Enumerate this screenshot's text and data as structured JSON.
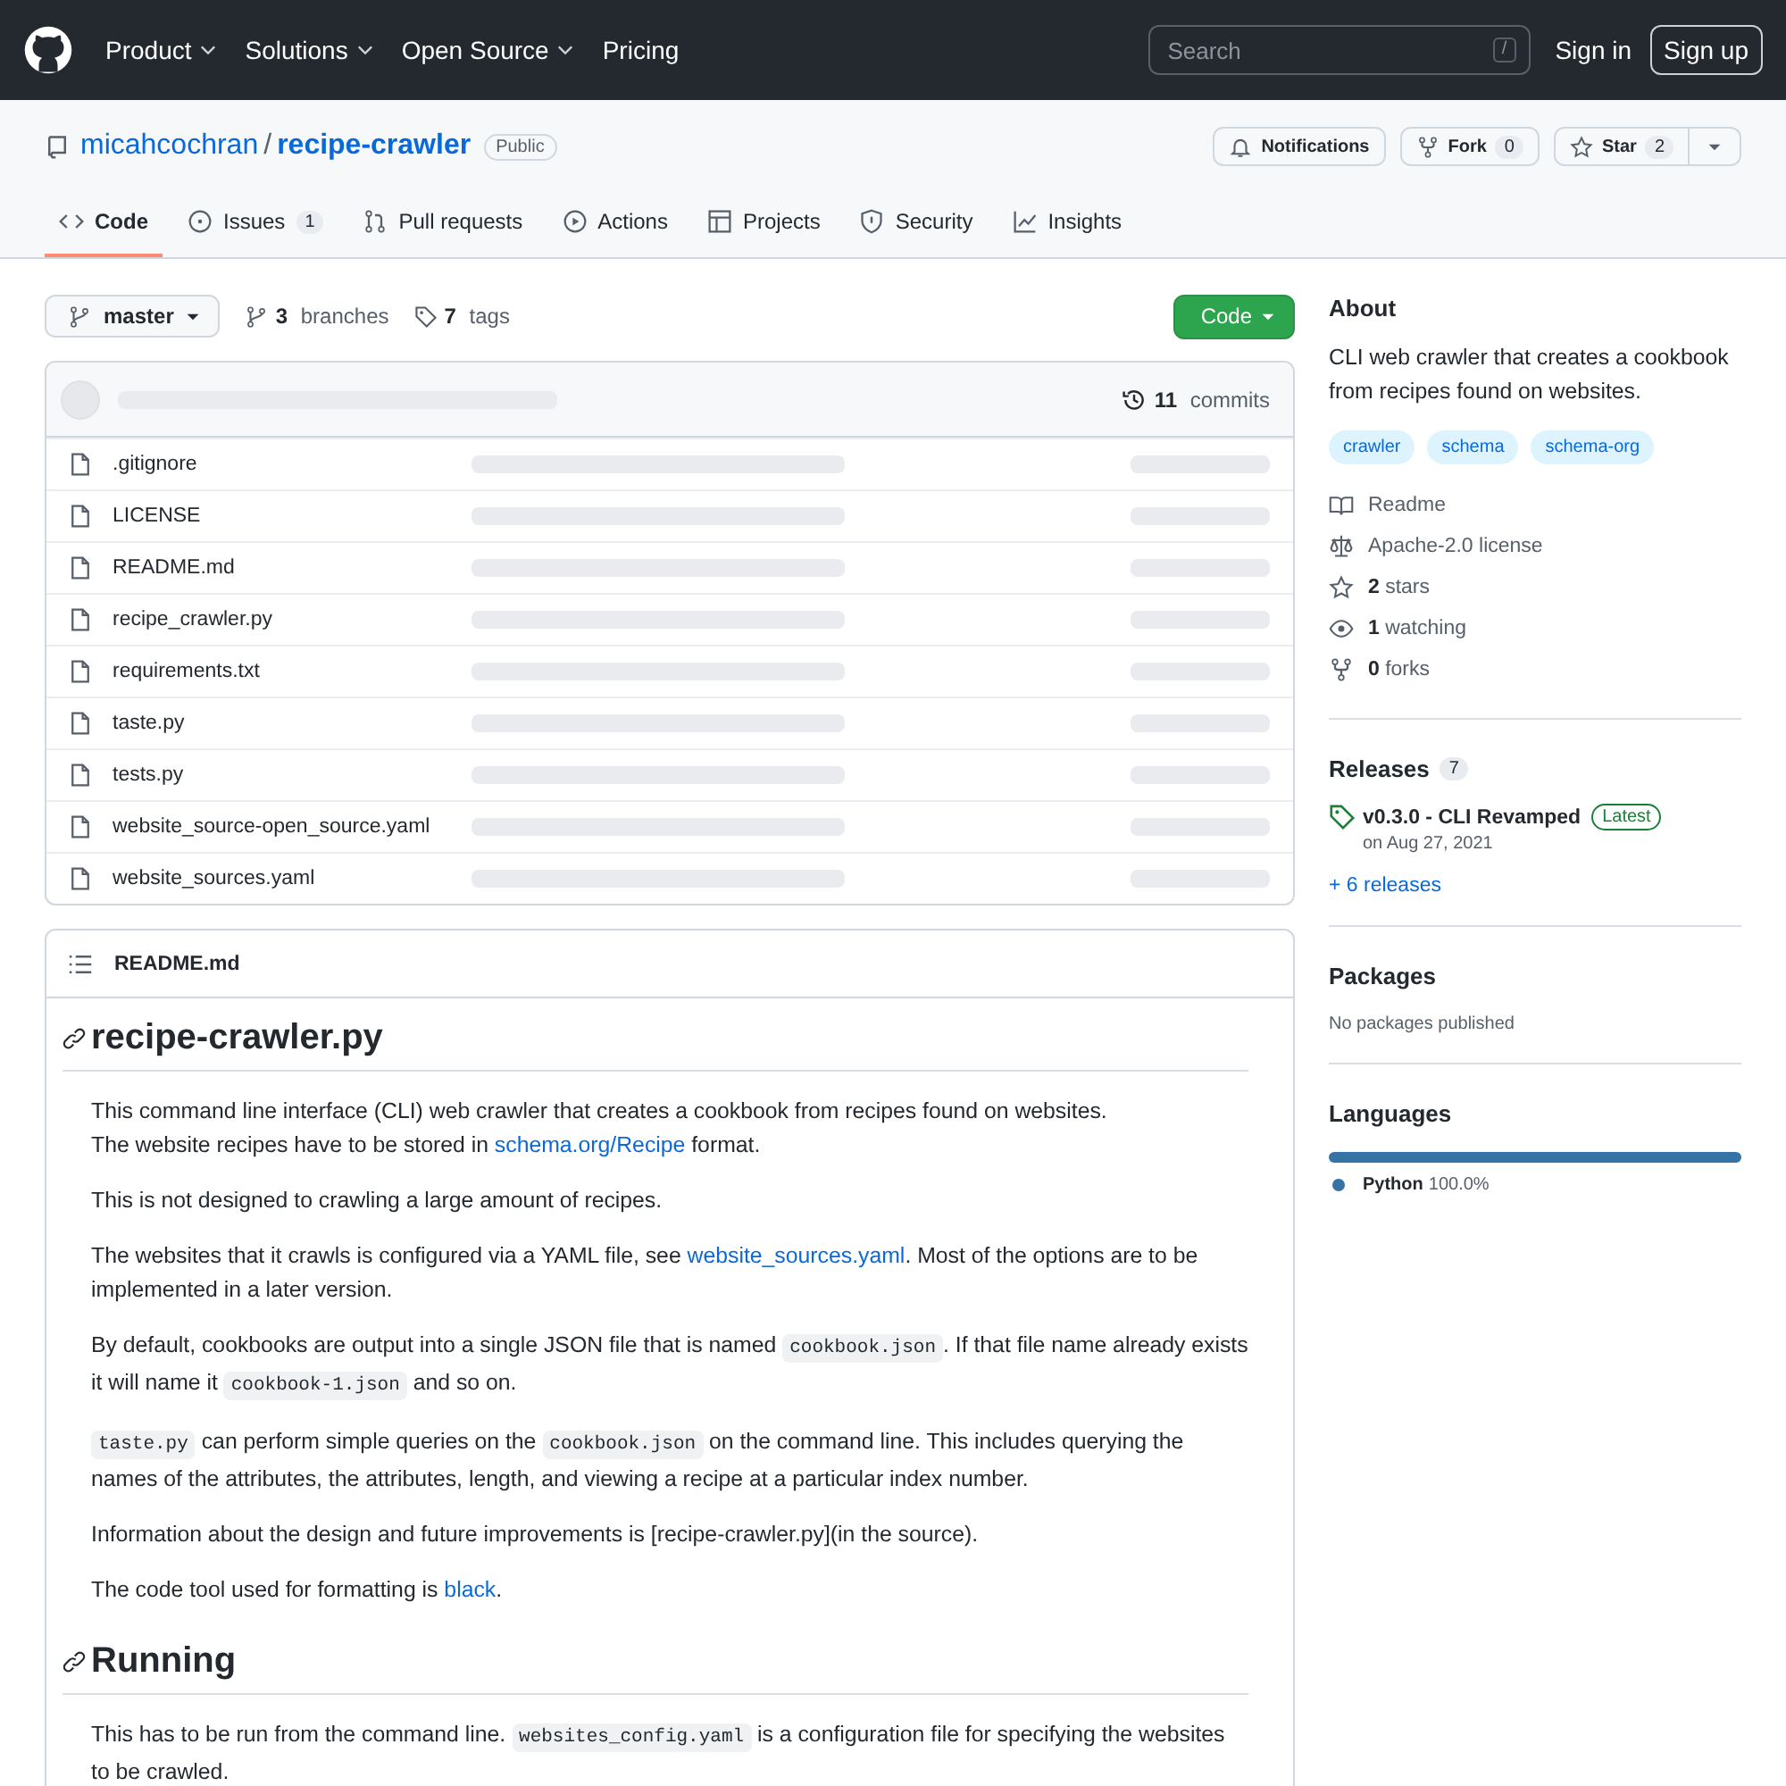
{
  "header": {
    "nav": [
      {
        "label": "Product",
        "dropdown": true
      },
      {
        "label": "Solutions",
        "dropdown": true
      },
      {
        "label": "Open Source",
        "dropdown": true
      },
      {
        "label": "Pricing",
        "dropdown": false
      }
    ],
    "search": {
      "placeholder": "Search",
      "key": "/"
    },
    "sign_in": "Sign in",
    "sign_up": "Sign up"
  },
  "repo": {
    "owner": "micahcochran",
    "separator": "/",
    "name": "recipe-crawler",
    "visibility": "Public",
    "actions": [
      {
        "label": "Notifications"
      },
      {
        "label": "Fork",
        "count": "0"
      },
      {
        "label": "Star",
        "count": "2"
      }
    ]
  },
  "tabs": [
    {
      "label": "Code",
      "selected": true
    },
    {
      "label": "Issues",
      "count": "1",
      "selected": false
    },
    {
      "label": "Pull requests",
      "selected": false
    },
    {
      "label": "Actions",
      "selected": false
    },
    {
      "label": "Projects",
      "selected": false
    },
    {
      "label": "Security",
      "selected": false
    },
    {
      "label": "Insights",
      "selected": false
    }
  ],
  "branch_bar": {
    "branch": "master",
    "branches": {
      "count": "3",
      "label": "branches"
    },
    "tags": {
      "count": "7",
      "label": "tags"
    },
    "code_button": "Code"
  },
  "commits": {
    "count": "11",
    "label": "commits"
  },
  "files": [
    ".gitignore",
    "LICENSE",
    "README.md",
    "recipe_crawler.py",
    "requirements.txt",
    "taste.py",
    "tests.py",
    "website_source-open_source.yaml",
    "website_sources.yaml"
  ],
  "readme": {
    "title": "README.md",
    "blocks": [
      {
        "kind": "h1",
        "text": "recipe-crawler.py"
      },
      {
        "kind": "p",
        "segments": [
          {
            "kind": "text",
            "text": "This command line interface (CLI) web crawler that creates a cookbook from recipes found on websites."
          },
          {
            "kind": "br"
          },
          {
            "kind": "text",
            "text": "The website recipes have to be stored in "
          },
          {
            "kind": "link",
            "text": "schema.org/Recipe"
          },
          {
            "kind": "text",
            "text": " format."
          }
        ]
      },
      {
        "kind": "p",
        "segments": [
          {
            "kind": "text",
            "text": "This is not designed to crawling a large amount of recipes."
          }
        ]
      },
      {
        "kind": "p",
        "segments": [
          {
            "kind": "text",
            "text": "The websites that it crawls is configured via a YAML file, see "
          },
          {
            "kind": "link",
            "text": "website_sources.yaml"
          },
          {
            "kind": "text",
            "text": ". Most of the options are to be implemented in a later version."
          }
        ]
      },
      {
        "kind": "p",
        "segments": [
          {
            "kind": "text",
            "text": "By default, cookbooks are output into a single JSON file that is named "
          },
          {
            "kind": "code",
            "text": "cookbook.json"
          },
          {
            "kind": "text",
            "text": ". If that file name already exists it will name it "
          },
          {
            "kind": "code",
            "text": "cookbook-1.json"
          },
          {
            "kind": "text",
            "text": " and so on."
          }
        ]
      },
      {
        "kind": "p",
        "segments": [
          {
            "kind": "code",
            "text": "taste.py"
          },
          {
            "kind": "text",
            "text": " can perform simple queries on the "
          },
          {
            "kind": "code",
            "text": "cookbook.json"
          },
          {
            "kind": "text",
            "text": " on the command line. This includes querying the names of the attributes, the attributes, length, and viewing a recipe at a particular index number."
          }
        ]
      },
      {
        "kind": "p",
        "segments": [
          {
            "kind": "text",
            "text": "Information about the design and future improvements is [recipe-crawler.py](in the source)."
          }
        ]
      },
      {
        "kind": "p",
        "segments": [
          {
            "kind": "text",
            "text": "The code tool used for formatting is "
          },
          {
            "kind": "link",
            "text": "black"
          },
          {
            "kind": "text",
            "text": "."
          }
        ]
      },
      {
        "kind": "h1",
        "text": "Running"
      },
      {
        "kind": "p",
        "segments": [
          {
            "kind": "text",
            "text": "This has to be run from the command line. "
          },
          {
            "kind": "code",
            "text": "websites_config.yaml"
          },
          {
            "kind": "text",
            "text": " is a configuration file for specifying the websites to be crawled."
          }
        ]
      }
    ]
  },
  "about": {
    "heading": "About",
    "description": "CLI web crawler that creates a cookbook from recipes found on websites.",
    "topics": [
      "crawler",
      "schema",
      "schema-org"
    ],
    "meta": [
      {
        "label": "Readme"
      },
      {
        "label": "Apache-2.0 license"
      },
      {
        "count": "2",
        "label": "stars"
      },
      {
        "count": "1",
        "label": "watching"
      },
      {
        "count": "0",
        "label": "forks"
      }
    ]
  },
  "releases": {
    "heading": "Releases",
    "count": "7",
    "latest": {
      "name": "v0.3.0 - CLI Revamped",
      "badge": "Latest",
      "date": "on Aug 27, 2021"
    },
    "more": "+ 6 releases"
  },
  "packages": {
    "heading": "Packages",
    "empty": "No packages published"
  },
  "languages": {
    "heading": "Languages",
    "items": [
      {
        "name": "Python",
        "percent": "100.0%",
        "color": "#3572a5",
        "level": 1.0
      }
    ]
  }
}
